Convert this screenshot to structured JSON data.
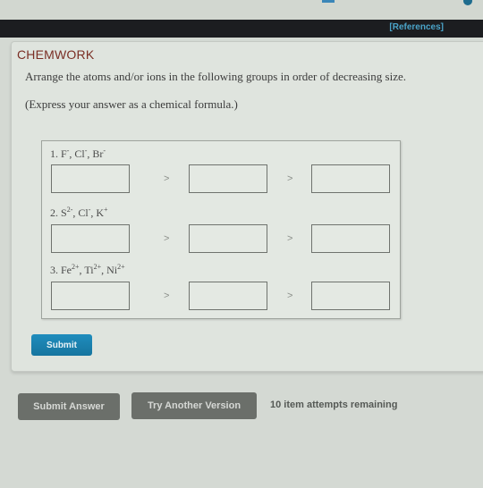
{
  "header": {
    "references_label": "[References]"
  },
  "card": {
    "brand": "CHEMWORK",
    "instruction": "Arrange the atoms and/or ions in the following groups in order of decreasing size.",
    "hint": "(Express your answer as a chemical formula.)"
  },
  "questions": [
    {
      "number": "1.",
      "species": [
        {
          "symbol": "F",
          "charge": "-"
        },
        {
          "symbol": "Cl",
          "charge": "-"
        },
        {
          "symbol": "Br",
          "charge": "-"
        }
      ],
      "answers": [
        "",
        "",
        ""
      ],
      "separator": ">"
    },
    {
      "number": "2.",
      "species": [
        {
          "symbol": "S",
          "charge": "2-"
        },
        {
          "symbol": "Cl",
          "charge": "-"
        },
        {
          "symbol": "K",
          "charge": "+"
        }
      ],
      "answers": [
        "",
        "",
        ""
      ],
      "separator": ">"
    },
    {
      "number": "3.",
      "species": [
        {
          "symbol": "Fe",
          "charge": "2+"
        },
        {
          "symbol": "Ti",
          "charge": "2+"
        },
        {
          "symbol": "Ni",
          "charge": "2+"
        }
      ],
      "answers": [
        "",
        "",
        ""
      ],
      "separator": ">"
    }
  ],
  "buttons": {
    "submit": "Submit",
    "submit_answer": "Submit Answer",
    "try_another": "Try Another Version"
  },
  "status": {
    "attempts": "10 item attempts remaining"
  },
  "colors": {
    "brand": "#7a2e24",
    "link": "#4aa4c9",
    "submit": "#1a82b0",
    "gray_button": "#6b6f6a"
  }
}
